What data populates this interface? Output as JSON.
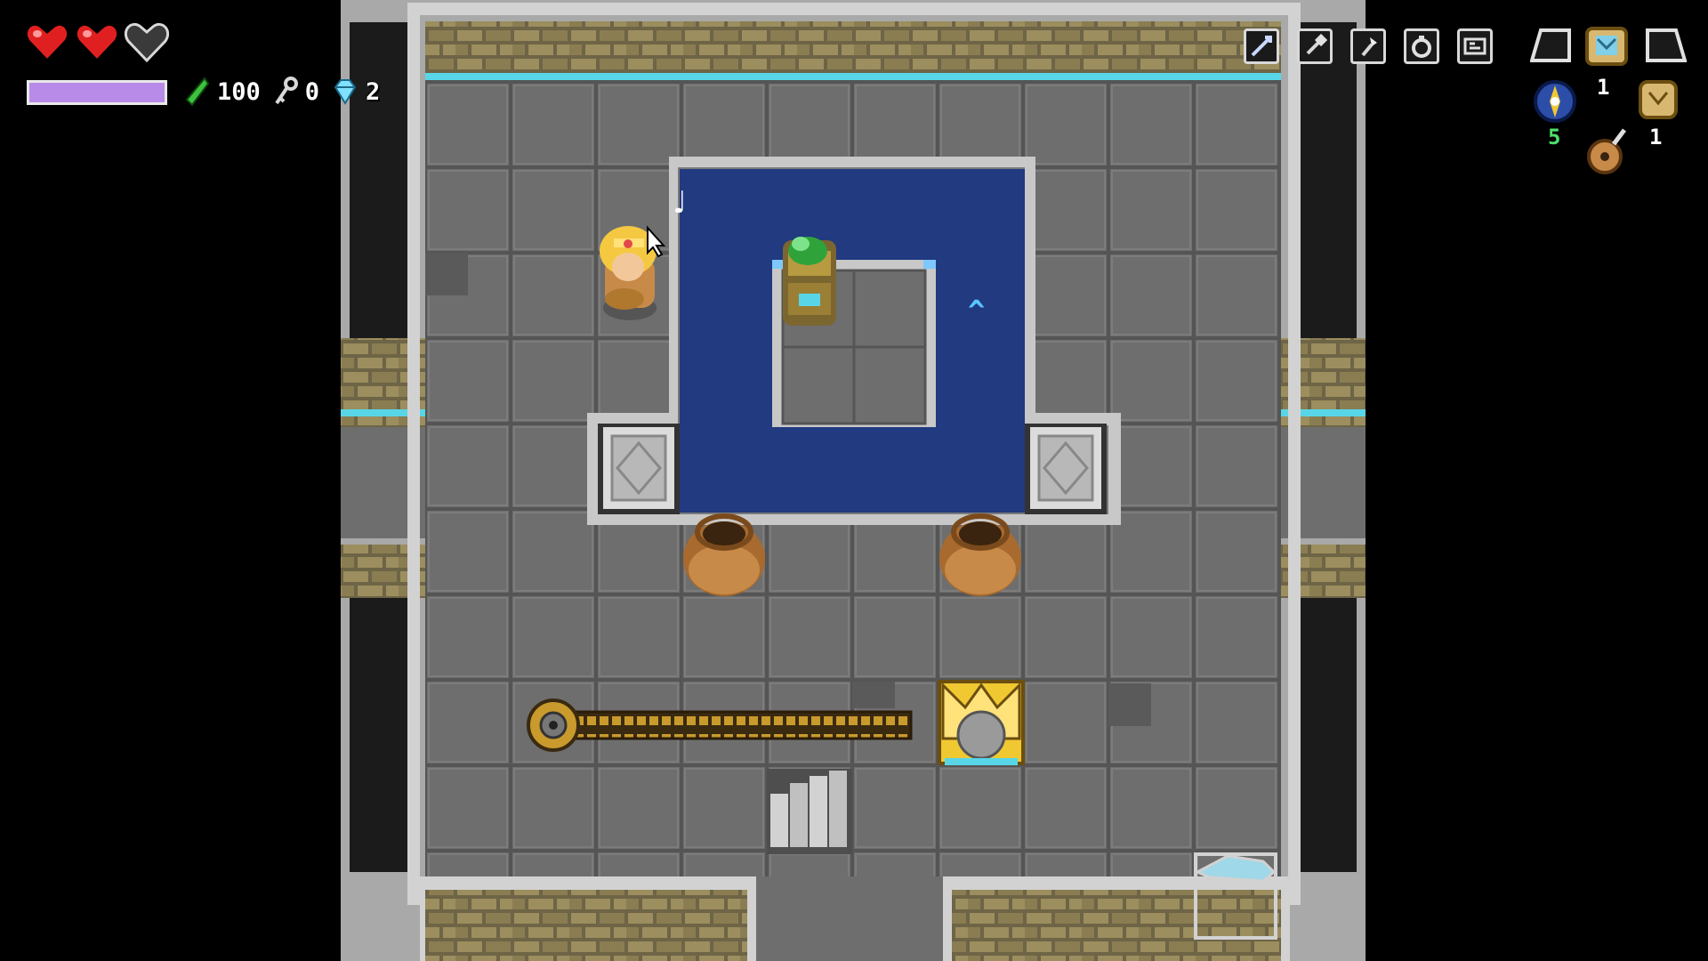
{
  "hud": {
    "hearts": {
      "full": 2,
      "empty": 1,
      "total": 3
    },
    "magic": {
      "fill": 1.0,
      "color": "#b98be8"
    },
    "counters": {
      "rupees": "100",
      "keys": "0",
      "diamonds": "2"
    },
    "equip_slots": [
      {
        "icon": "spear-icon"
      },
      {
        "icon": "shovel-icon"
      },
      {
        "icon": "torch-icon"
      },
      {
        "icon": "ring-icon"
      },
      {
        "icon": "card-icon"
      }
    ],
    "inventory": {
      "map_count": "1",
      "compass_count": "5",
      "scroll_count": "1"
    }
  },
  "scene": {
    "music_note": "♩",
    "water_arrow": "^",
    "colors": {
      "floor": "#6b6b6b",
      "wall": "#d2d2d2",
      "water": "#213a80",
      "brick": "#8a7a50",
      "void": "#000000",
      "cyan_trim": "#58d6e8"
    }
  }
}
